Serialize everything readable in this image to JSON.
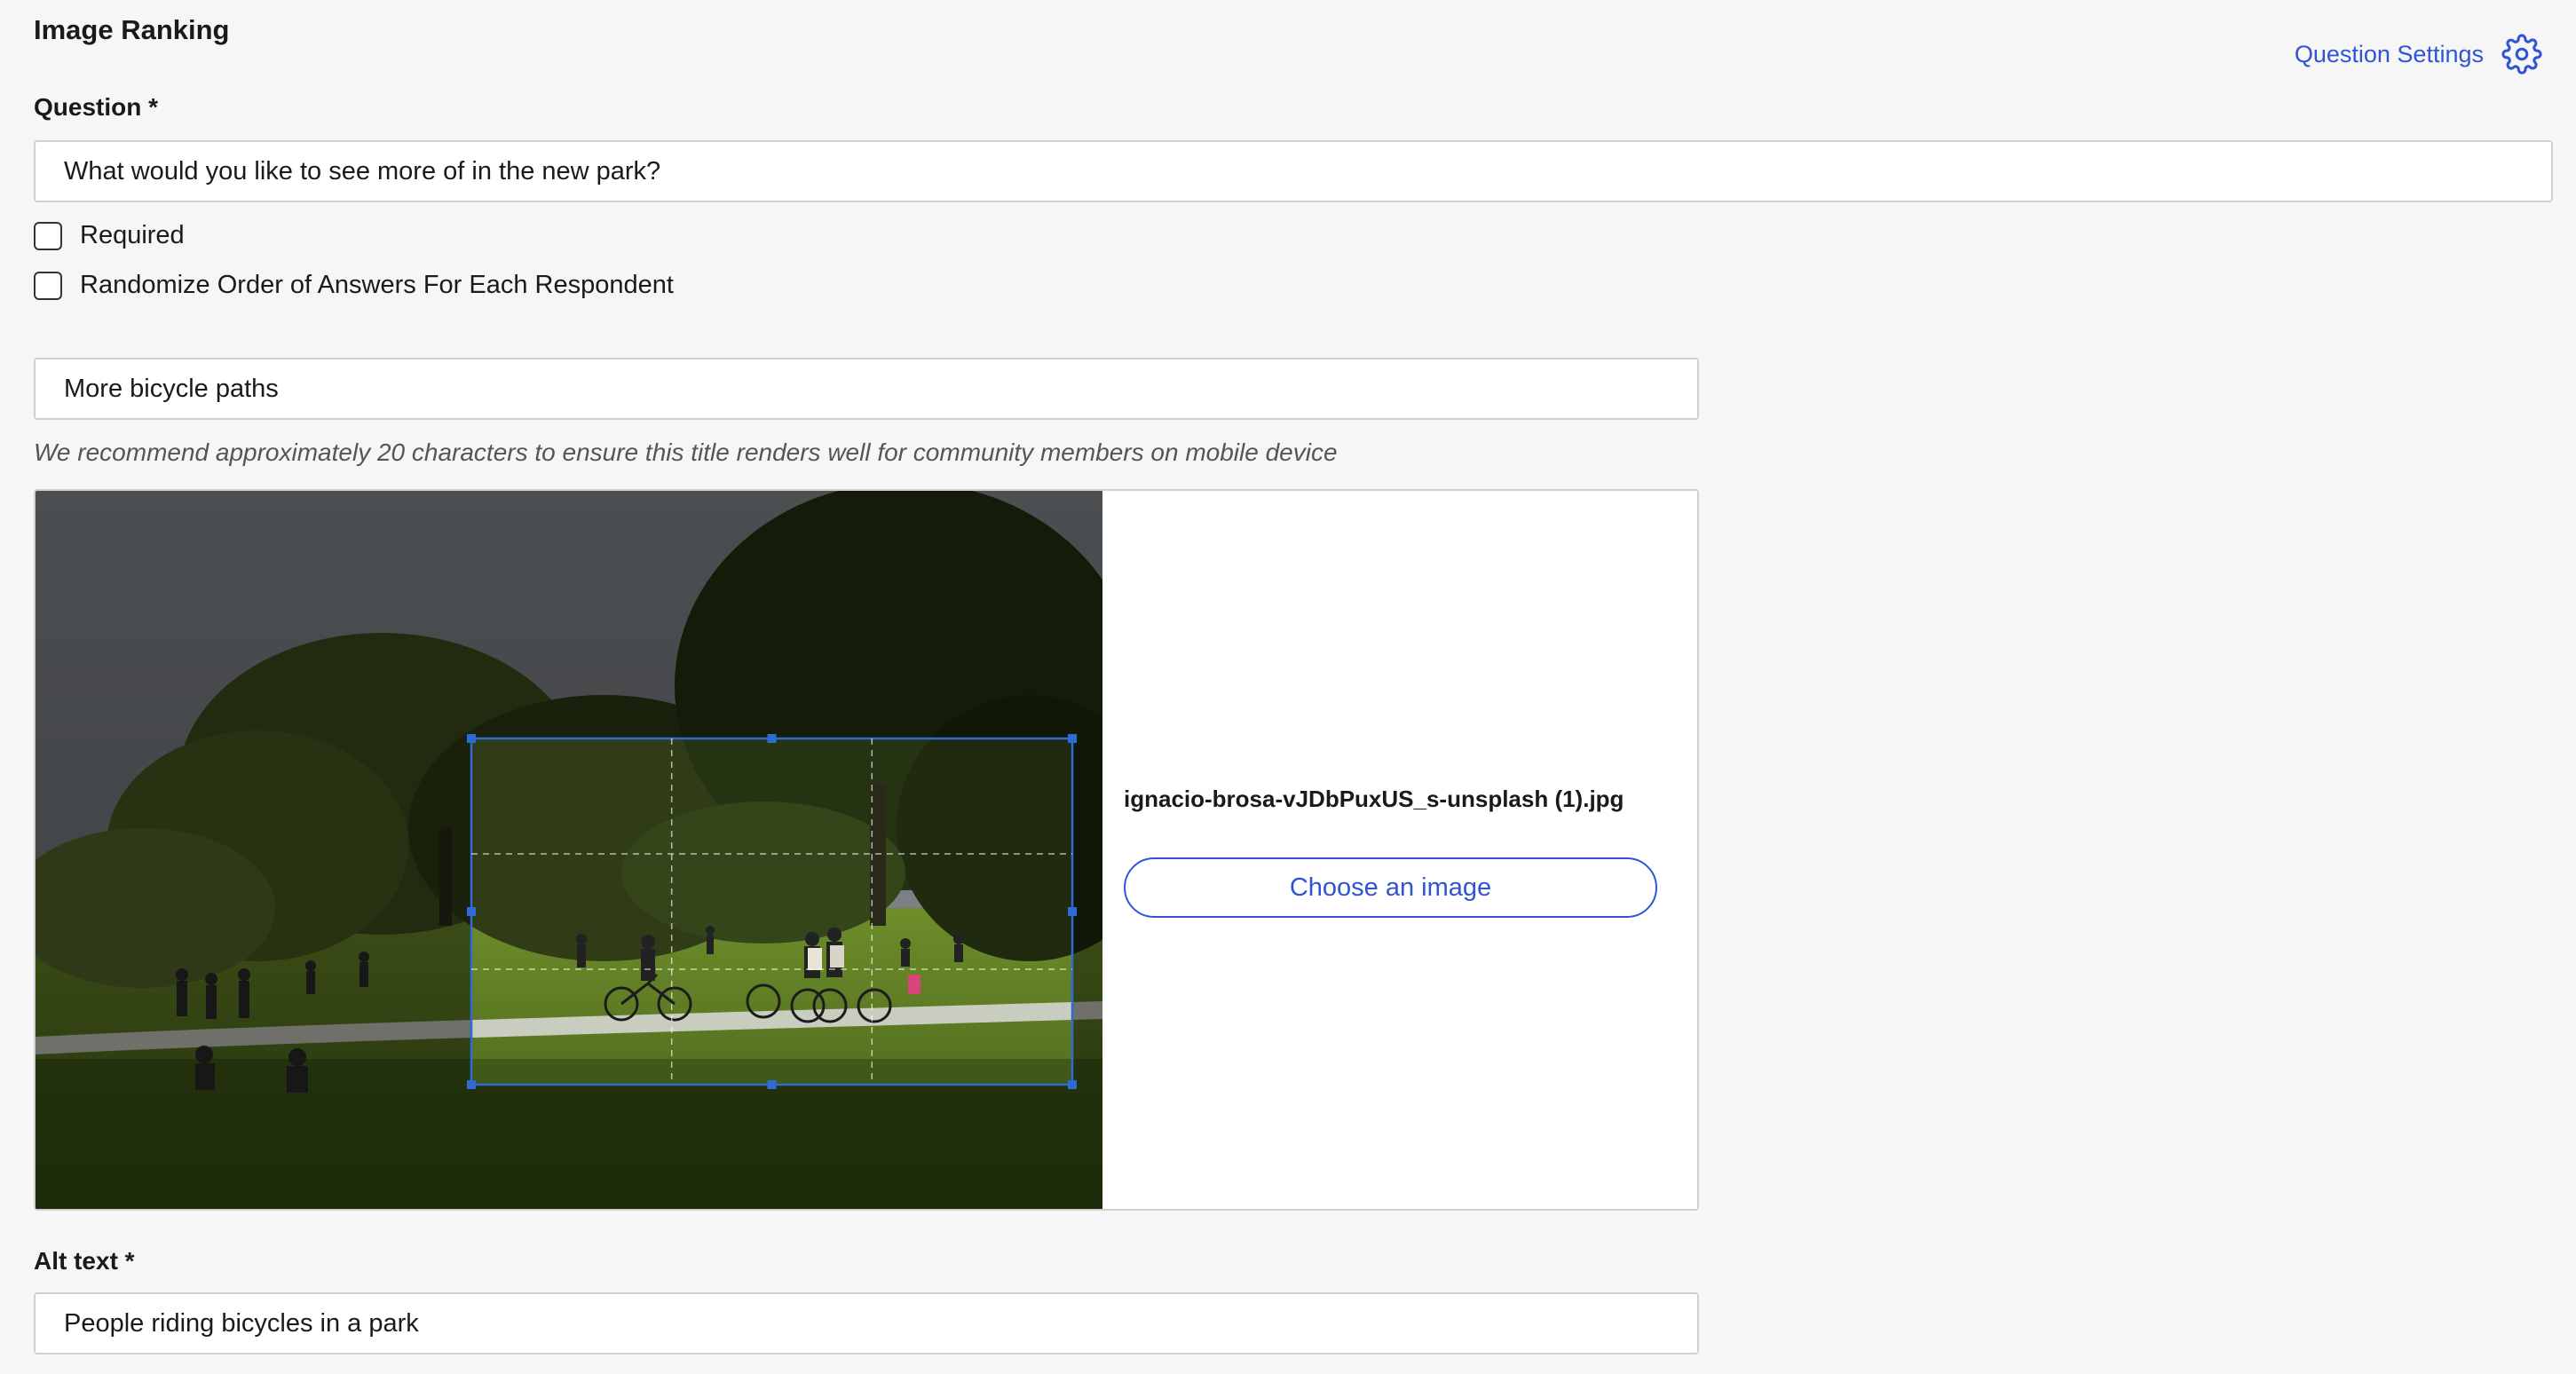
{
  "header": {
    "title": "Image Ranking",
    "settings_label": "Question Settings",
    "settings_icon": "gear-icon"
  },
  "question": {
    "label": "Question *",
    "value": "What would you like to see more of in the new park?"
  },
  "options": {
    "required_label": "Required",
    "required_checked": false,
    "randomize_label": "Randomize Order of Answers For Each Respondent",
    "randomize_checked": false
  },
  "answer": {
    "title_value": "More bicycle paths",
    "hint": "We recommend approximately 20 characters to ensure this title renders well for community members on mobile device",
    "image_filename": "ignacio-brosa-vJDbPuxUS_s-unsplash (1).jpg",
    "choose_image_label": "Choose an image",
    "alt_label": "Alt text *",
    "alt_value": "People riding bicycles in a park"
  },
  "colors": {
    "accent": "#2f55d4",
    "background": "#f6f6f6",
    "border": "#d0d0d0"
  }
}
